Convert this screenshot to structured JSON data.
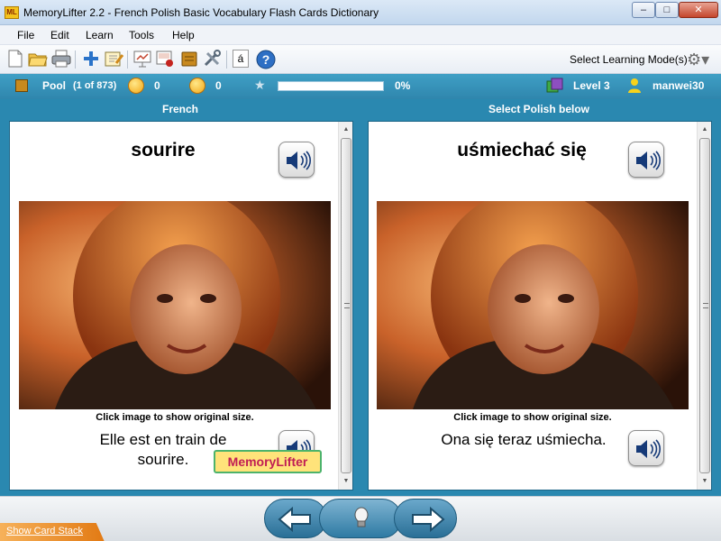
{
  "window": {
    "title": "MemoryLifter 2.2 - French Polish Basic Vocabulary Flash Cards Dictionary",
    "app_icon_text": "ML",
    "minimize": "–",
    "maximize": "□",
    "close": "✕"
  },
  "menu": [
    "File",
    "Edit",
    "Learn",
    "Tools",
    "Help"
  ],
  "toolbar": {
    "icons": [
      "new-document-icon",
      "open-folder-icon",
      "print-icon",
      "add-card-icon",
      "edit-card-icon",
      "presentation-icon",
      "slideshow-icon",
      "card-box-icon",
      "tools-icon",
      "special-characters-icon",
      "help-icon"
    ],
    "char_button": "á",
    "help_glyph": "?",
    "learning_mode_label": "Select Learning Mode(s)"
  },
  "stats": {
    "pool_label": "Pool",
    "pool_count": "(1 of 873)",
    "happy_count": "0",
    "sad_count": "0",
    "progress_percent": "0%",
    "progress_value": 0,
    "level": "Level 3",
    "username": "manwei30"
  },
  "colors": {
    "accent_blue": "#2a88b0",
    "progress_green": "#3fbb3f",
    "stack_orange": "#e27a14"
  },
  "left": {
    "header": "French",
    "word": "sourire",
    "caption": "Click image to show original size.",
    "sentence": "Elle est en train de sourire.",
    "logo_text": "MemoryLifter"
  },
  "right": {
    "header": "Select Polish below",
    "word": "uśmiechać się",
    "caption": "Click image to show original size.",
    "sentence": "Ona się teraz uśmiecha."
  },
  "bottom": {
    "show_card_stack": "Show Card Stack"
  }
}
